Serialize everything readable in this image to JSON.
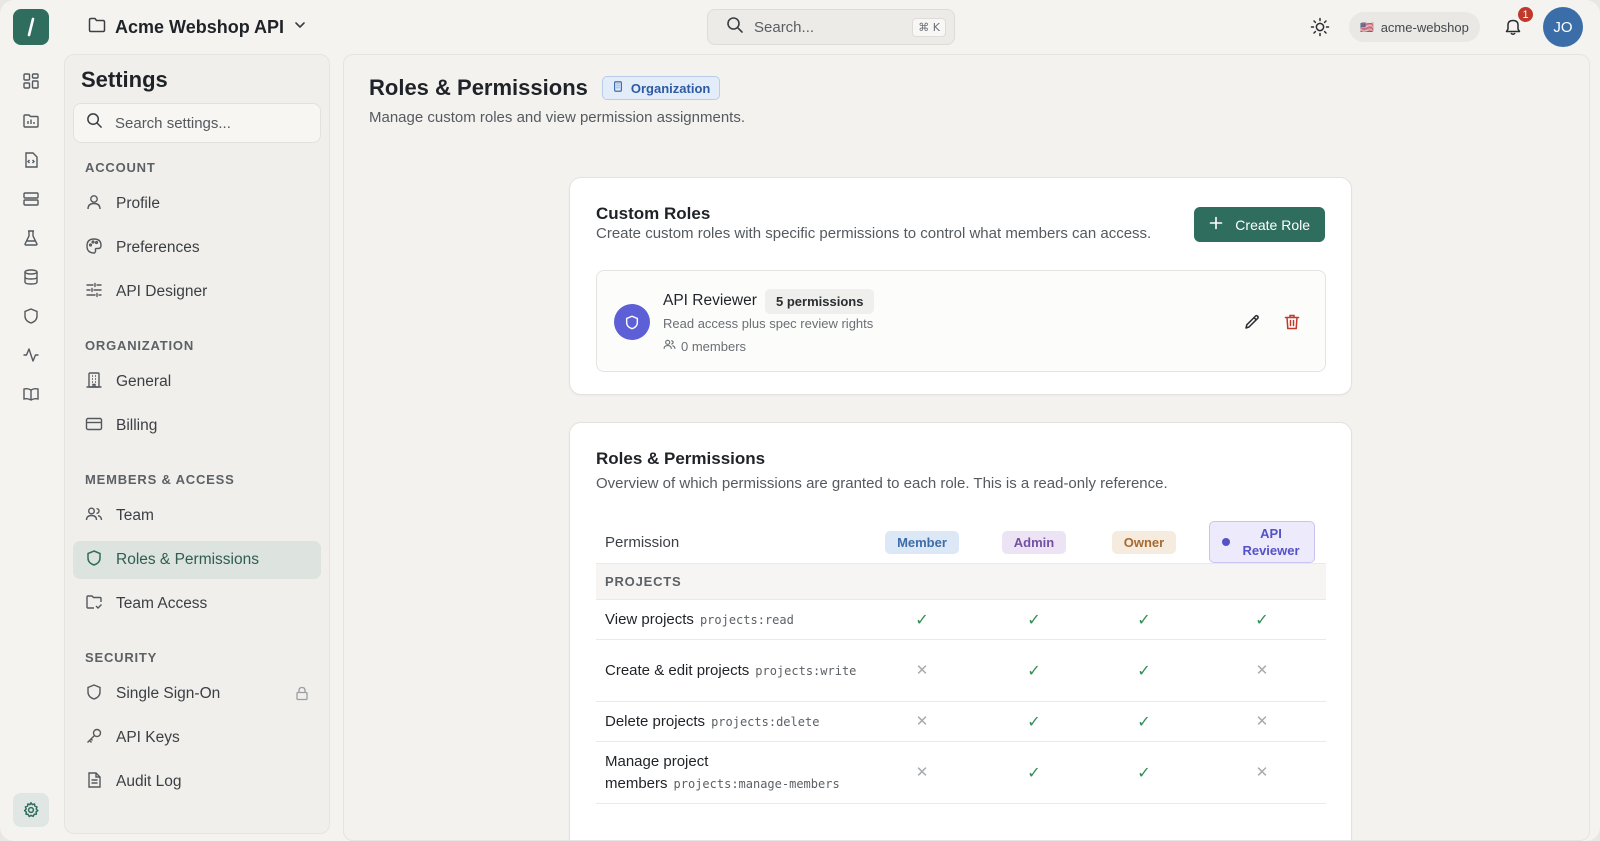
{
  "topbar": {
    "project_name": "Acme Webshop API",
    "search_placeholder": "Search...",
    "search_shortcut": "⌘ K",
    "org_flag": "🇺🇸",
    "org_name": "acme-webshop",
    "notification_count": "1",
    "avatar_initials": "JO"
  },
  "rail": {
    "icons": [
      "dashboard-icon",
      "project-folder-icon",
      "code-file-icon",
      "server-icon",
      "flask-icon",
      "database-icon",
      "shield-icon",
      "activity-icon",
      "book-icon"
    ],
    "bottom": "gear-icon"
  },
  "sidebar": {
    "title": "Settings",
    "search_placeholder": "Search settings...",
    "sections": [
      {
        "label": "ACCOUNT",
        "items": [
          "Profile",
          "Preferences",
          "API Designer"
        ]
      },
      {
        "label": "ORGANIZATION",
        "items": [
          "General",
          "Billing"
        ]
      },
      {
        "label": "MEMBERS & ACCESS",
        "items": [
          "Team",
          "Roles & Permissions",
          "Team Access"
        ]
      },
      {
        "label": "SECURITY",
        "items": [
          "Single Sign-On",
          "API Keys",
          "Audit Log"
        ]
      }
    ],
    "active_item": "Roles & Permissions"
  },
  "page": {
    "title": "Roles & Permissions",
    "badge": "Organization",
    "subtitle": "Manage custom roles and view permission assignments."
  },
  "custom_roles": {
    "title": "Custom Roles",
    "subtitle": "Create custom roles with specific permissions to control what members can access.",
    "create_button": "Create Role",
    "roles": [
      {
        "name": "API Reviewer",
        "permissions_badge": "5 permissions",
        "description": "Read access plus spec review rights",
        "members": "0 members"
      }
    ]
  },
  "permissions_overview": {
    "title": "Roles & Permissions",
    "subtitle": "Overview of which permissions are granted to each role. This is a read-only reference.",
    "column_permission": "Permission",
    "roles": [
      "Member",
      "Admin",
      "Owner",
      "API Reviewer"
    ],
    "groups": [
      {
        "label": "PROJECTS",
        "rows": [
          {
            "name": "View projects",
            "code": "projects:read",
            "grants": [
              true,
              true,
              true,
              true
            ]
          },
          {
            "name": "Create & edit projects",
            "code": "projects:write",
            "grants": [
              false,
              true,
              true,
              false
            ]
          },
          {
            "name": "Delete projects",
            "code": "projects:delete",
            "grants": [
              false,
              true,
              true,
              false
            ]
          },
          {
            "name": "Manage project members",
            "code": "projects:manage-members",
            "grants": [
              false,
              true,
              true,
              false
            ]
          }
        ]
      }
    ]
  },
  "colors": {
    "brand": "#2f6e5f",
    "check": "#2f8f55",
    "danger": "#c0392b",
    "api_reviewer": "#5c5fd6"
  }
}
